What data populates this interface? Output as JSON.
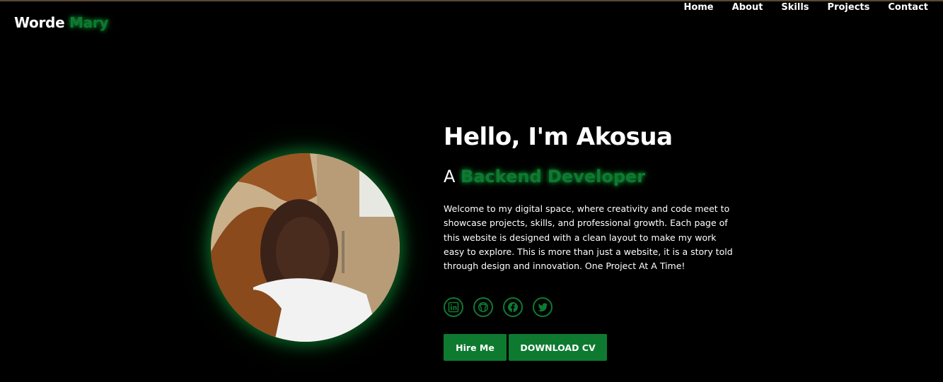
{
  "logo": {
    "first": "Worde",
    "second": "Mary"
  },
  "nav": {
    "items": [
      "Home",
      "About",
      "Skills",
      "Projects",
      "Contact"
    ]
  },
  "hero": {
    "title": "Hello, I'm Akosua",
    "prefix": "A",
    "role": "Backend Developer",
    "description": "Welcome to my digital space, where creativity and code meet to showcase projects, skills, and professional growth. Each page of this website is designed with a clean layout to make my work easy to explore. This is more than just a website, it is a story told through design and innovation. One Project At A Time!"
  },
  "socials": [
    "linkedin-icon",
    "github-icon",
    "facebook-icon",
    "twitter-icon"
  ],
  "buttons": {
    "hire": "Hire Me",
    "cv": "DOWNLOAD CV"
  },
  "colors": {
    "accent": "#0e7a30",
    "background": "#000000",
    "text": "#ffffff"
  }
}
